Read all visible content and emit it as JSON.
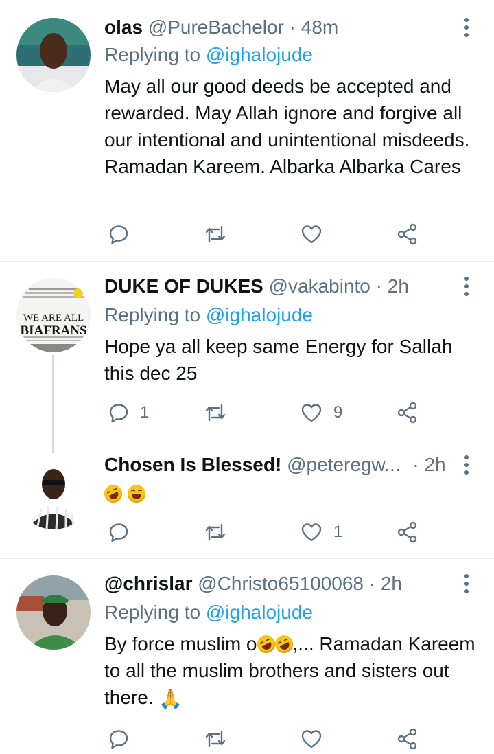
{
  "replying_prefix": "Replying to",
  "tweets": [
    {
      "name": "olas",
      "handle": "@PureBachelor",
      "separator": "·",
      "time": "48m",
      "reply_to": "@ighalojude",
      "body": "May all our good deeds be accepted and rewarded. May Allah ignore and forgive all our intentional and unintentional misdeeds. Ramadan Kareem. Albarka Albarka Cares",
      "replies": "",
      "retweets": "",
      "likes": ""
    },
    {
      "name": "DUKE OF DUKES",
      "handle": "@vakabinto",
      "separator": "·",
      "time": "2h",
      "reply_to": "@ighalojude",
      "avatar_text_line1": "WE ARE ALL",
      "avatar_text_line2": "BIAFRANS",
      "body": "Hope ya all keep same Energy for Sallah this dec 25",
      "replies": "1",
      "retweets": "",
      "likes": "9"
    },
    {
      "name": "Chosen Is Blessed!",
      "handle": "@peteregw...",
      "separator": "·",
      "time": "2h",
      "emoji_names": [
        "rolling-on-floor-laughing-emoji",
        "grinning-sweat-emoji"
      ],
      "replies": "",
      "retweets": "",
      "likes": "1"
    },
    {
      "name": "@chrislar",
      "handle": "@Christo65100068",
      "separator": "·",
      "time": "2h",
      "reply_to": "@ighalojude",
      "body_part1": "By force muslim o",
      "body_part2": ",... Ramadan Kareem to all the muslim brothers and sisters out there.",
      "body_emoji": "🙏",
      "replies": "",
      "retweets": "",
      "likes": ""
    }
  ],
  "icons": [
    "reply-icon",
    "retweet-icon",
    "like-icon",
    "share-icon",
    "more-options-icon"
  ],
  "colors": {
    "text": "#0f1419",
    "secondary": "#5b7083",
    "link": "#1da1f2",
    "divider": "#e6ecf0"
  }
}
